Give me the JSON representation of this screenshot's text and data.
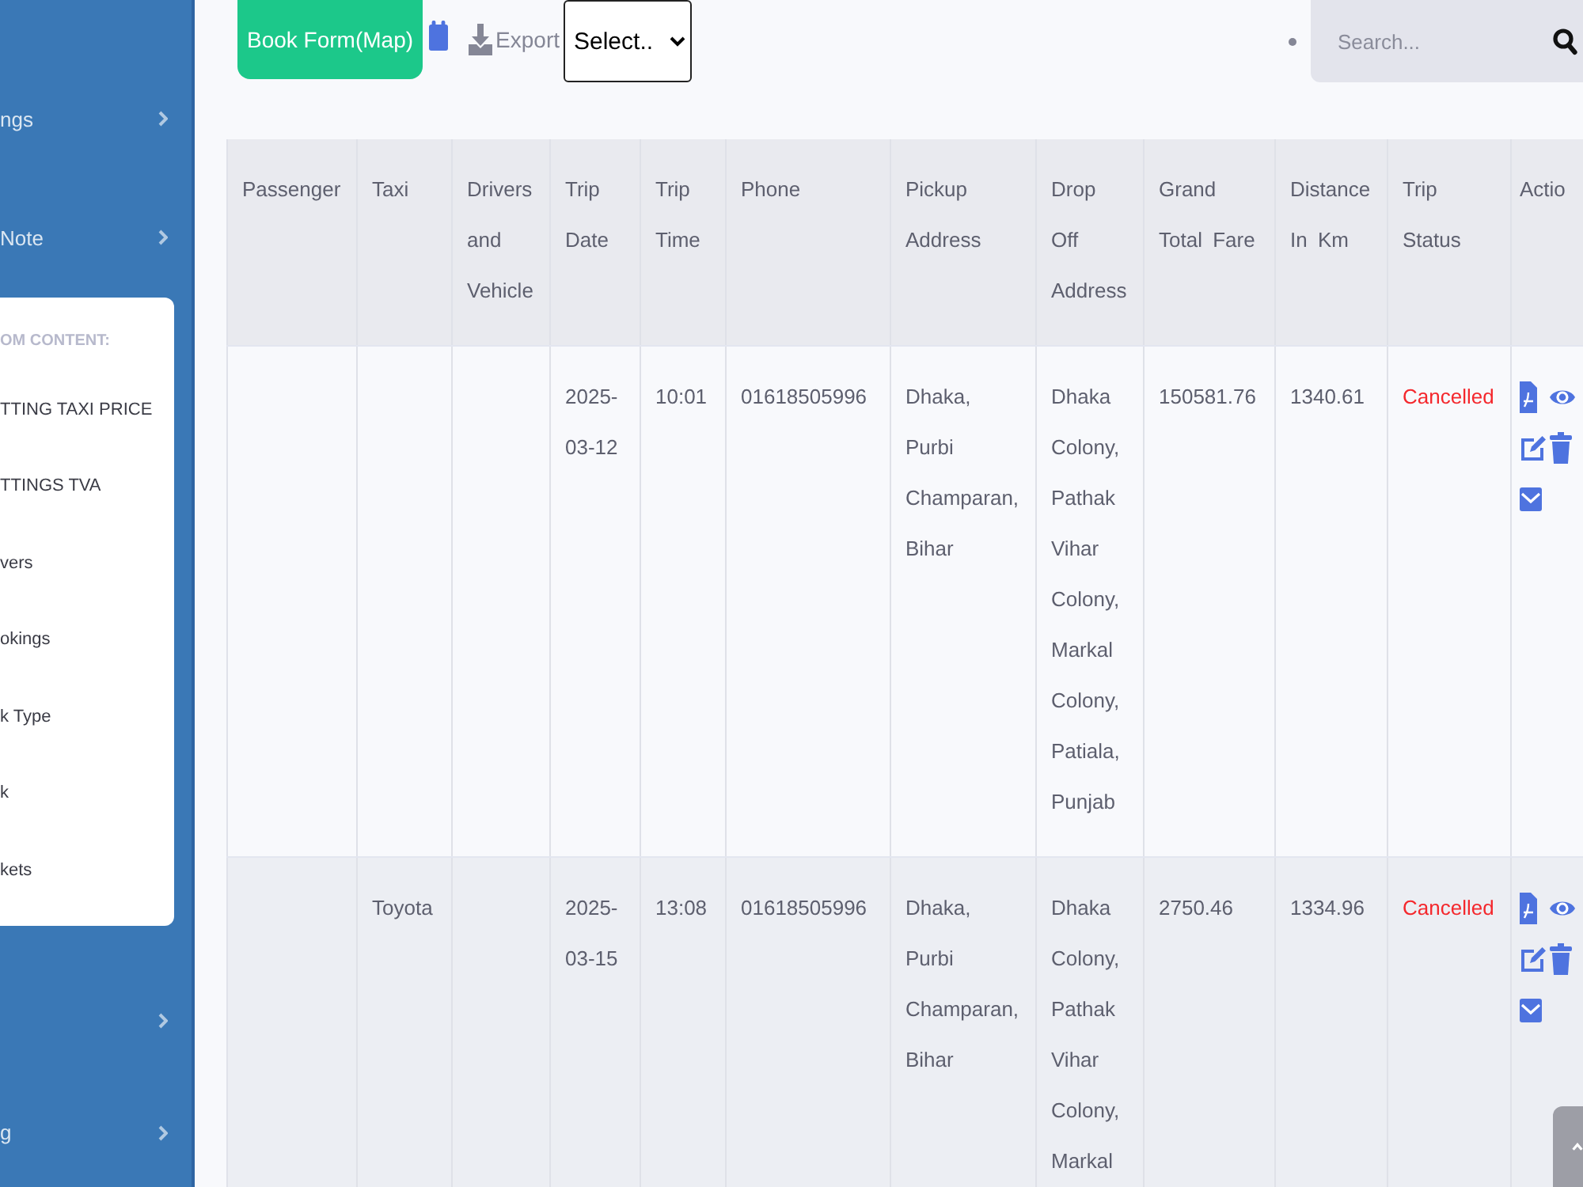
{
  "sidebar": {
    "items": [
      {
        "label": "ngs",
        "collapsible": true
      },
      {
        "label": "Note",
        "collapsible": true,
        "submenu": {
          "header": "OM CONTENT:",
          "items": [
            "TTING TAXI PRICE",
            "TTINGS TVA",
            "vers",
            "okings",
            "k Type",
            "k",
            "kets"
          ]
        }
      },
      {
        "collapsible": true
      },
      {
        "label": "g",
        "collapsible": true
      }
    ]
  },
  "toolbar": {
    "book_button": "Book Form(Map)",
    "export_button": "Export",
    "select": {
      "value": "Select.."
    },
    "search": {
      "placeholder": "Search..."
    }
  },
  "table": {
    "columns": [
      "Passenger",
      "Taxi",
      "Drivers and Vehicle",
      "Trip Date",
      "Trip Time",
      "Phone",
      "Pickup Address",
      "Drop Off Address",
      "Grand Total Fare",
      "Distance In Km",
      "Trip Status",
      "Actio"
    ],
    "rows": [
      {
        "trip_date": "2025-03-12",
        "trip_time": "10:01",
        "phone": "01618505996",
        "pickup_address": "Dhaka, Purbi Champaran, Bihar",
        "drop_off_address": "Dhaka Colony, Pathak Vihar Colony, Markal Colony, Patiala, Punjab",
        "grand_total_fare": "150581.76",
        "distance_in_km": "1340.61",
        "trip_status": {
          "label": "Cancelled",
          "color": "#f4282d"
        }
      },
      {
        "taxi": "Toyota",
        "trip_date": "2025-03-15",
        "trip_time": "13:08",
        "phone": "01618505996",
        "pickup_address": "Dhaka, Purbi Champaran, Bihar",
        "drop_off_address": "Dhaka Colony, Pathak Vihar Colony, Markal",
        "grand_total_fare": "2750.46",
        "distance_in_km": "1334.96",
        "trip_status": {
          "label": "Cancelled",
          "color": "#f4282d"
        }
      }
    ]
  }
}
